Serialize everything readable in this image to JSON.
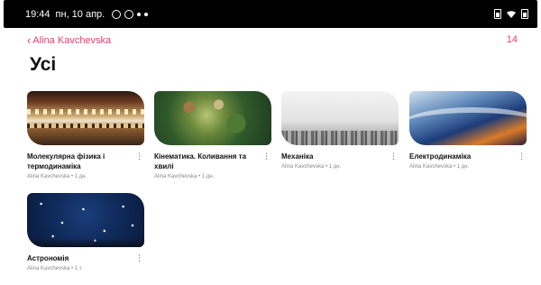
{
  "status_bar": {
    "time": "19:44",
    "date": "пн, 10 апр."
  },
  "nav": {
    "back_label": "Alina Kavchevska",
    "count": "14"
  },
  "page": {
    "title": "Усі"
  },
  "cards": [
    {
      "title": "Молекулярна фізика і термодинаміка",
      "meta": "Alina Kavchevska • 1 дн."
    },
    {
      "title": "Кінематика. Коливання та хвилі",
      "meta": "Alina Kavchevska • 1 дн."
    },
    {
      "title": "Механіка",
      "meta": "Alina Kavchevska • 1 дн."
    },
    {
      "title": "Електродинаміка",
      "meta": "Alina Kavchevska • 1 дн."
    },
    {
      "title": "Астрономія",
      "meta": "Alina Kavchevska • 1 т."
    }
  ],
  "colors": {
    "accent": "#e8406b",
    "status_bar_bg": "#000000"
  },
  "icons": {
    "back": "chevron-left-icon",
    "more": "more-vertical-icon",
    "wifi": "wifi-icon",
    "battery": "battery-icon"
  }
}
